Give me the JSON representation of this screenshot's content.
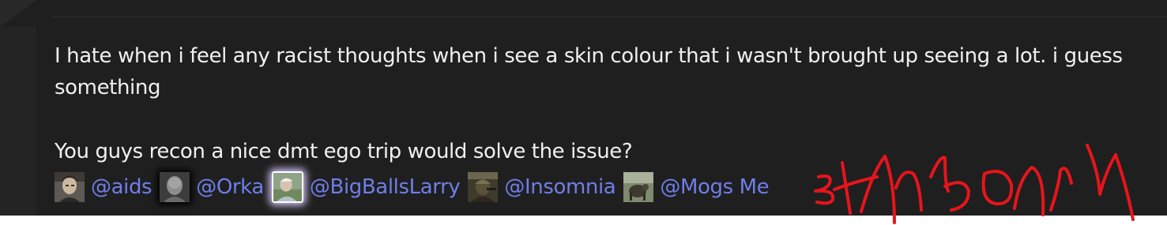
{
  "message": {
    "line1": "I hate when i feel any racist thoughts when i see a skin colour that i wasn't brought up seeing a lot. i guess",
    "line2": "something",
    "line3": "You guys recon a nice dmt ego trip would solve the issue?"
  },
  "mentions": [
    {
      "handle": "@aids",
      "avatar_icon": "avatar-man-portrait"
    },
    {
      "handle": "@Orka",
      "avatar_icon": "avatar-grey-portrait"
    },
    {
      "handle": "@BigBallsLarry",
      "avatar_icon": "avatar-outdoor-photo"
    },
    {
      "handle": "@Insomnia",
      "avatar_icon": "avatar-soldier-photo"
    },
    {
      "handle": "@Mogs Me",
      "avatar_icon": "avatar-creature-photo"
    }
  ],
  "colors": {
    "background": "#1f1f1f",
    "text": "#f0f0f0",
    "mention": "#6f7ee8",
    "scribble": "#e8141b"
  }
}
